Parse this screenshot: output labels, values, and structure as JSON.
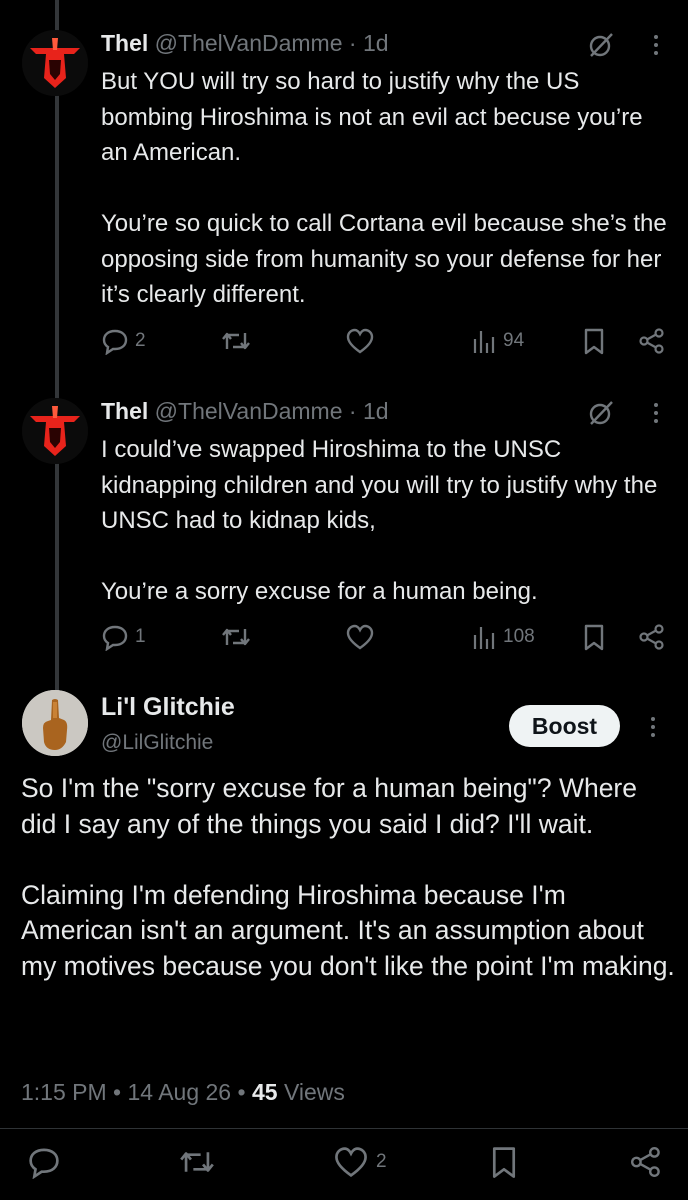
{
  "replies": [
    {
      "name": "Thel",
      "handle": "@ThelVanDamme",
      "time": "1d",
      "text": "But YOU will try so hard to justify why the US bombing Hiroshima is not an evil act becuse you’re an American.\n\nYou’re so quick to call Cortana evil because she’s the opposing side from humanity so your defense for her it’s clearly different.",
      "replies": "2",
      "views": "94"
    },
    {
      "name": "Thel",
      "handle": "@ThelVanDamme",
      "time": "1d",
      "text": "I could’ve swapped Hiroshima to the UNSC kidnapping children and you will try to justify why the UNSC had to kidnap kids,\n\nYou’re a sorry excuse for a human being.",
      "replies": "1",
      "views": "108"
    }
  ],
  "main": {
    "name": "Li'l Glitchie",
    "handle": "@LilGlitchie",
    "boost_label": "Boost",
    "text": "So I'm the \"sorry excuse for a human being\"? Where did I say any of the things you said I did? I'll wait.\n\nClaiming I'm defending Hiroshima because I'm American isn't an argument. It's an assumption about my motives because you don't like the point I'm making.",
    "time": "1:15 PM",
    "date": "14 Aug 26",
    "views_count": "45",
    "views_label": "Views",
    "likes": "2"
  },
  "separator": "·",
  "colors": {
    "background": "#000000",
    "text": "#e7e9ea",
    "muted": "#71767b",
    "avatar_red": "#e8231b"
  }
}
